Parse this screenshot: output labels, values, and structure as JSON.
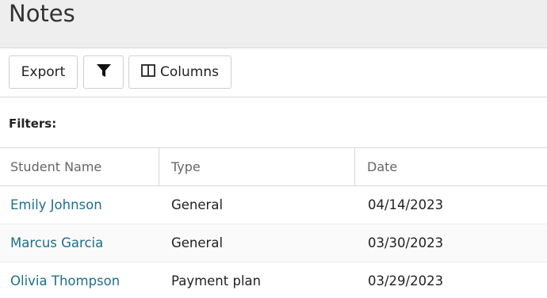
{
  "header": {
    "title": "Notes"
  },
  "toolbar": {
    "export_label": "Export",
    "filter_icon": "filter-icon",
    "columns_icon": "columns-icon",
    "columns_label": "Columns"
  },
  "filters": {
    "label": "Filters:"
  },
  "table": {
    "columns": [
      "Student Name",
      "Type",
      "Date"
    ],
    "rows": [
      {
        "student": "Emily Johnson",
        "type": "General",
        "date": "04/14/2023"
      },
      {
        "student": "Marcus Garcia",
        "type": "General",
        "date": "03/30/2023"
      },
      {
        "student": "Olivia Thompson",
        "type": "Payment plan",
        "date": "03/29/2023"
      }
    ]
  },
  "colors": {
    "header_bg": "#eeeeee",
    "link": "#1f6f8b",
    "border": "#d9d9d9"
  }
}
